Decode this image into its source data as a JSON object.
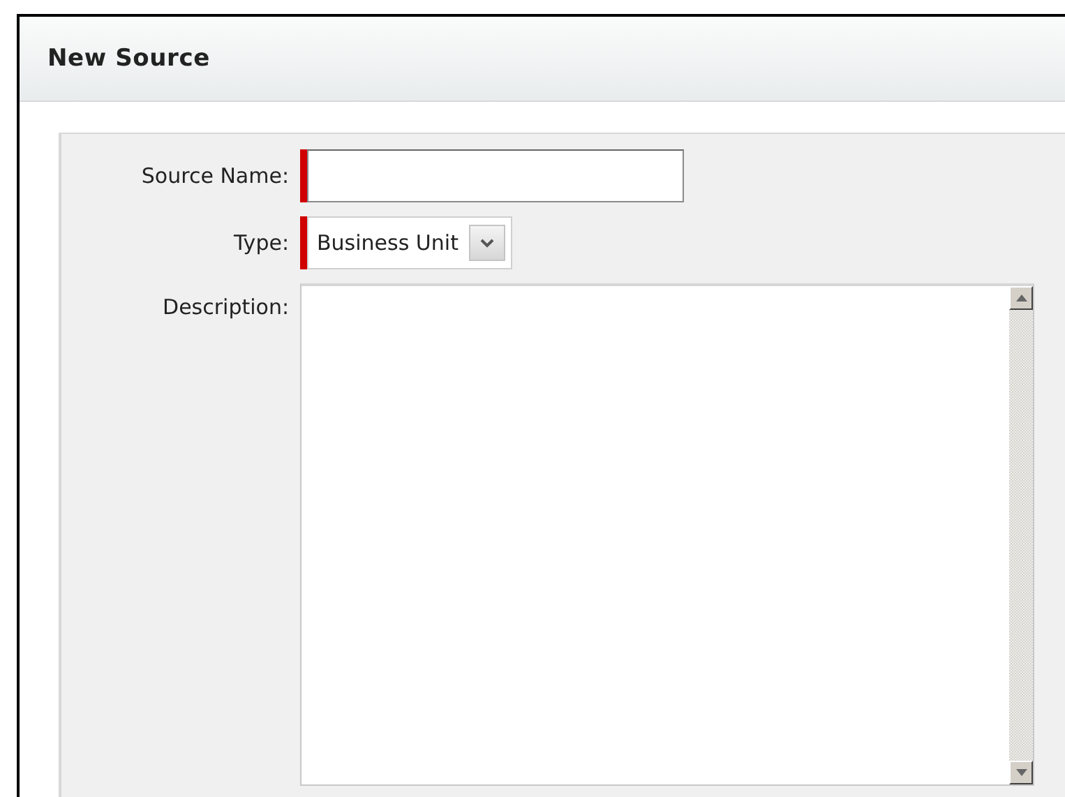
{
  "dialog": {
    "title": "New Source"
  },
  "fields": [
    {
      "kind": "text",
      "label": "Source Name:",
      "required": true
    },
    {
      "kind": "select",
      "label": "Type:",
      "required": true,
      "value": "Business Unit"
    },
    {
      "kind": "textarea",
      "label": "Description:",
      "required": false
    }
  ]
}
